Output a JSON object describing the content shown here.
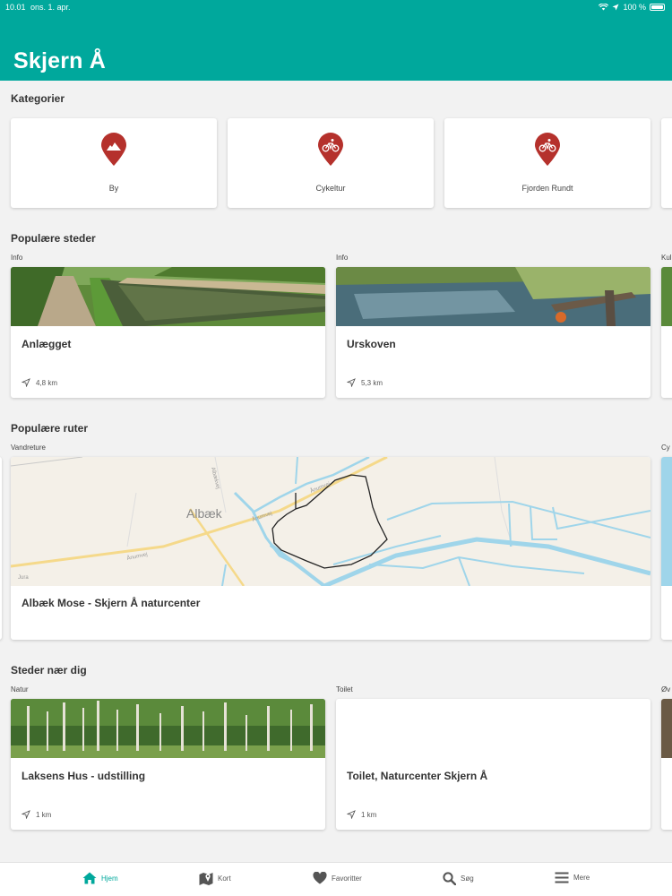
{
  "status_bar": {
    "time": "10.01",
    "date": "ons. 1. apr.",
    "battery": "100 %"
  },
  "app": {
    "title": "Skjern Å"
  },
  "categories": {
    "title": "Kategorier",
    "items": [
      {
        "label": "By",
        "icon": "city-icon"
      },
      {
        "label": "Cykeltur",
        "icon": "bicycle-icon"
      },
      {
        "label": "Fjorden Rundt",
        "icon": "bicycle-icon"
      }
    ]
  },
  "popular_places": {
    "title": "Populære steder",
    "items": [
      {
        "category": "Info",
        "title": "Anlægget",
        "distance": "4,8 km"
      },
      {
        "category": "Info",
        "title": "Urskoven",
        "distance": "5,3 km"
      },
      {
        "category": "Kul"
      }
    ]
  },
  "popular_routes": {
    "title": "Populære ruter",
    "items": [
      {
        "category": "Vandreture",
        "title": "Albæk Mose - Skjern Å naturcenter",
        "map_place": "Albæk",
        "road": "Ånumvej",
        "road2": "Albækvej",
        "map_credit": "Jura"
      },
      {
        "category": "Cy"
      }
    ]
  },
  "nearby": {
    "title": "Steder nær dig",
    "items": [
      {
        "category": "Natur",
        "title": "Laksens Hus - udstilling",
        "distance": "1 km"
      },
      {
        "category": "Toilet",
        "title": "Toilet, Naturcenter Skjern Å",
        "distance": "1 km"
      },
      {
        "category": "Øv"
      }
    ]
  },
  "tabbar": {
    "tabs": [
      {
        "label": "Hjem",
        "icon": "home-icon",
        "active": true
      },
      {
        "label": "Kort",
        "icon": "map-icon"
      },
      {
        "label": "Favoritter",
        "icon": "heart-icon"
      },
      {
        "label": "Søg",
        "icon": "search-icon"
      },
      {
        "label": "Mere",
        "icon": "menu-icon"
      }
    ]
  },
  "colors": {
    "accent": "#00a89c",
    "pin": "#b5312c",
    "background": "#f2f2f2"
  }
}
